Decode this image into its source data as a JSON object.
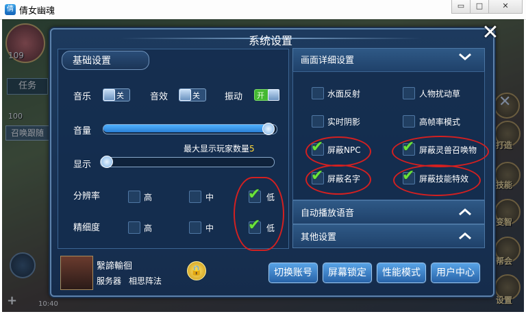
{
  "window": {
    "title": "倩女幽魂",
    "icon_name": "app-icon",
    "minimize_glyph": "▭",
    "maximize_glyph": "□",
    "close_glyph": "✕"
  },
  "dialog": {
    "title": "系统设置",
    "close_glyph": "✕"
  },
  "basic": {
    "header": "基础设置",
    "music_label": "音乐",
    "music_state": "关",
    "sfx_label": "音效",
    "sfx_state": "关",
    "vibrate_label": "振动",
    "vibrate_state": "开",
    "volume_label": "音量",
    "volume_level": 0.98,
    "display_label": "显示",
    "display_level": 0.0,
    "max_players_label": "最大显示玩家数量",
    "max_players_value": "5",
    "resolution_label": "分辨率",
    "detail_label": "精细度",
    "opt_high": "高",
    "opt_mid": "中",
    "opt_low": "低",
    "resolution_selected": "低",
    "detail_selected": "低"
  },
  "graphics": {
    "header": "画面详细设置",
    "options": [
      {
        "label": "水面反射",
        "checked": false
      },
      {
        "label": "人物扰动草",
        "checked": false
      },
      {
        "label": "实时阴影",
        "checked": false
      },
      {
        "label": "高帧率模式",
        "checked": false
      },
      {
        "label": "屏蔽NPC",
        "checked": true
      },
      {
        "label": "屏蔽灵兽召唤物",
        "checked": true
      },
      {
        "label": "屏蔽名字",
        "checked": true
      },
      {
        "label": "屏蔽技能特效",
        "checked": true
      }
    ],
    "check_glyph": "✔"
  },
  "sections": {
    "auto_voice": "自动播放语音",
    "other": "其他设置"
  },
  "player": {
    "name": "繄諦輸徊",
    "server_label": "服务器",
    "server_name": "相思阵法"
  },
  "buttons": {
    "switch_account": "切换账号",
    "lock_screen": "屏幕锁定",
    "performance": "性能模式",
    "user_center": "用户中心"
  },
  "hud": {
    "level": "109",
    "level2": "100",
    "task_label": "任务",
    "summon_label": "召唤跟随",
    "build_label": "打造",
    "skill_label": "技能",
    "change_label": "变智",
    "gang_label": "帮会",
    "settings_label": "设置",
    "time": "10:40"
  },
  "colors": {
    "accent": "#2a7fd4",
    "check": "#6be33a",
    "annotation": "#d42020"
  }
}
